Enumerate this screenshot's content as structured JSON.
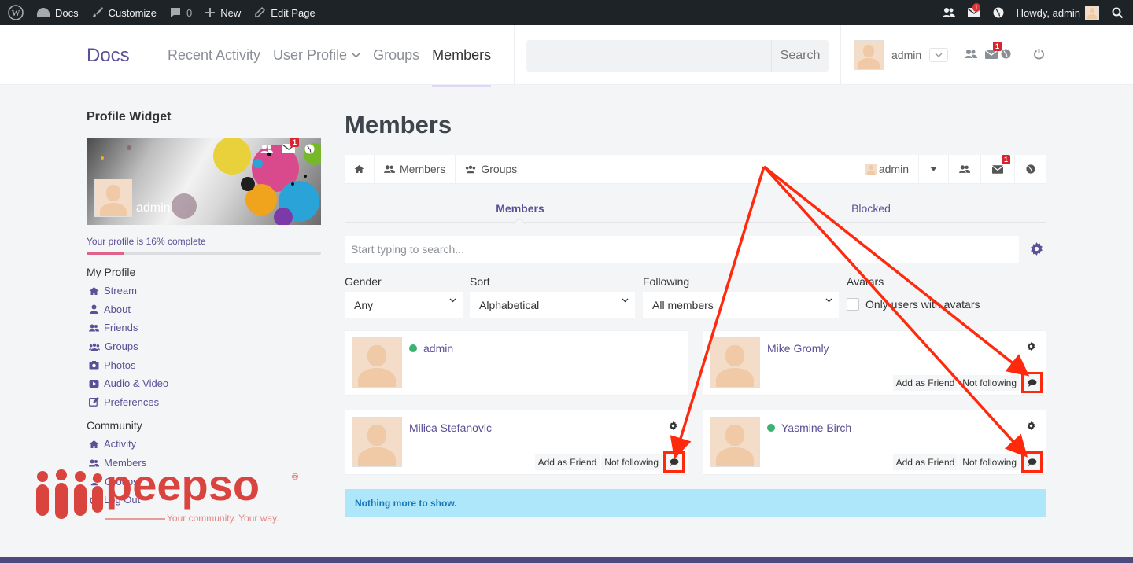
{
  "adminbar": {
    "site": "Docs",
    "customize": "Customize",
    "comments_count": "0",
    "new": "New",
    "edit_page": "Edit Page",
    "notif_badge": "1",
    "greeting": "Howdy, admin"
  },
  "header": {
    "logo": "Docs",
    "nav": [
      "Recent Activity",
      "User Profile",
      "Groups",
      "Members"
    ],
    "search_button": "Search",
    "search_placeholder": "",
    "username": "admin",
    "notif_badge": "1"
  },
  "sidebar": {
    "widget_title": "Profile Widget",
    "cover_name": "admin",
    "cover_badge": "1",
    "progress_text": "Your profile is 16% complete",
    "progress_pct": 16,
    "my_profile_title": "My Profile",
    "my_profile_items": [
      "Stream",
      "About",
      "Friends",
      "Groups",
      "Photos",
      "Audio & Video",
      "Preferences"
    ],
    "community_title": "Community",
    "community_items": [
      "Activity",
      "Members",
      "Groups",
      "Log Out"
    ]
  },
  "main": {
    "title": "Members",
    "subnav": {
      "members": "Members",
      "groups": "Groups",
      "user": "admin",
      "badge": "1"
    },
    "tabs": [
      "Members",
      "Blocked"
    ],
    "search_placeholder": "Start typing to search...",
    "filters": {
      "gender": {
        "label": "Gender",
        "value": "Any"
      },
      "sort": {
        "label": "Sort",
        "value": "Alphabetical"
      },
      "following": {
        "label": "Following",
        "value": "All members"
      },
      "avatars": {
        "label": "Avatars",
        "option": "Only users with avatars"
      }
    },
    "members": [
      {
        "name": "admin",
        "online": true,
        "actions": false
      },
      {
        "name": "Mike Gromly",
        "online": false,
        "actions": true,
        "add_friend": "Add as Friend",
        "follow": "Not following"
      },
      {
        "name": "Milica Stefanovic",
        "online": false,
        "actions": true,
        "add_friend": "Add as Friend",
        "follow": "Not following"
      },
      {
        "name": "Yasmine Birch",
        "online": true,
        "actions": true,
        "add_friend": "Add as Friend",
        "follow": "Not following"
      }
    ],
    "nothing_more": "Nothing more to show."
  },
  "brand": {
    "logo": "peepso",
    "registered": "®",
    "tagline": "Your community. Your way."
  },
  "colors": {
    "accent": "#5b4f96",
    "adminbar": "#1d2327",
    "annotation": "#ff2a0e",
    "online": "#3cb371",
    "info_bg": "#aee6fa"
  }
}
